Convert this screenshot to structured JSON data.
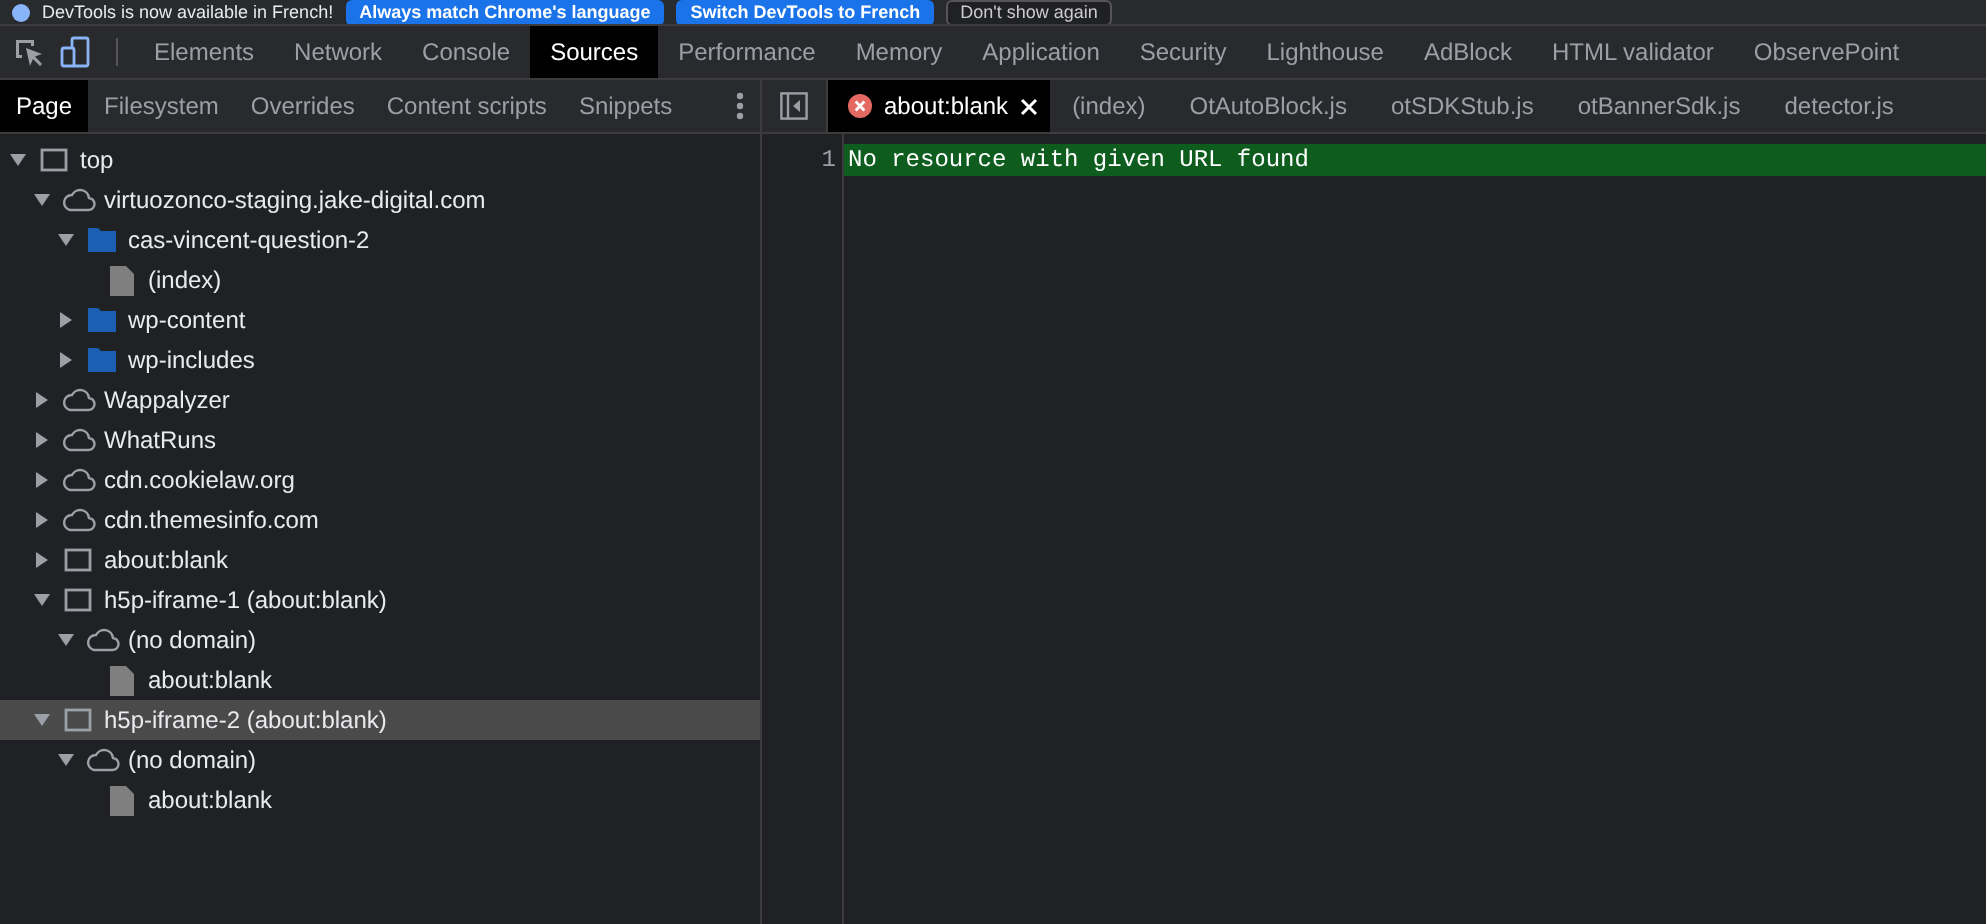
{
  "infobar": {
    "message": "DevTools is now available in French!",
    "buttons": [
      {
        "label": "Always match Chrome's language",
        "kind": "primary"
      },
      {
        "label": "Switch DevTools to French",
        "kind": "primary"
      },
      {
        "label": "Don't show again",
        "kind": "secondary"
      }
    ]
  },
  "main_tabs": [
    {
      "label": "Elements",
      "selected": false
    },
    {
      "label": "Network",
      "selected": false
    },
    {
      "label": "Console",
      "selected": false
    },
    {
      "label": "Sources",
      "selected": true
    },
    {
      "label": "Performance",
      "selected": false
    },
    {
      "label": "Memory",
      "selected": false
    },
    {
      "label": "Application",
      "selected": false
    },
    {
      "label": "Security",
      "selected": false
    },
    {
      "label": "Lighthouse",
      "selected": false
    },
    {
      "label": "AdBlock",
      "selected": false
    },
    {
      "label": "HTML validator",
      "selected": false
    },
    {
      "label": "ObservePoint",
      "selected": false
    }
  ],
  "navigator_tabs": [
    {
      "label": "Page",
      "selected": true
    },
    {
      "label": "Filesystem",
      "selected": false
    },
    {
      "label": "Overrides",
      "selected": false
    },
    {
      "label": "Content scripts",
      "selected": false
    },
    {
      "label": "Snippets",
      "selected": false
    }
  ],
  "tree": [
    {
      "label": "top",
      "kind": "frame",
      "expanded": true,
      "selected": false,
      "children": [
        {
          "label": "virtuozonco-staging.jake-digital.com",
          "kind": "domain",
          "expanded": true,
          "selected": false,
          "children": [
            {
              "label": "cas-vincent-question-2",
              "kind": "folder",
              "expanded": true,
              "selected": false,
              "children": [
                {
                  "label": "(index)",
                  "kind": "file",
                  "selected": false
                }
              ]
            },
            {
              "label": "wp-content",
              "kind": "folder",
              "expanded": false,
              "selected": false
            },
            {
              "label": "wp-includes",
              "kind": "folder",
              "expanded": false,
              "selected": false
            }
          ]
        },
        {
          "label": "Wappalyzer",
          "kind": "domain",
          "expanded": false,
          "selected": false
        },
        {
          "label": "WhatRuns",
          "kind": "domain",
          "expanded": false,
          "selected": false
        },
        {
          "label": "cdn.cookielaw.org",
          "kind": "domain",
          "expanded": false,
          "selected": false
        },
        {
          "label": "cdn.themesinfo.com",
          "kind": "domain",
          "expanded": false,
          "selected": false
        },
        {
          "label": "about:blank",
          "kind": "frame",
          "expanded": false,
          "selected": false
        },
        {
          "label": "h5p-iframe-1 (about:blank)",
          "kind": "frame",
          "expanded": true,
          "selected": false,
          "children": [
            {
              "label": "(no domain)",
              "kind": "domain",
              "expanded": true,
              "selected": false,
              "children": [
                {
                  "label": "about:blank",
                  "kind": "file",
                  "selected": false
                }
              ]
            }
          ]
        },
        {
          "label": "h5p-iframe-2 (about:blank)",
          "kind": "frame",
          "expanded": true,
          "selected": true,
          "children": [
            {
              "label": "(no domain)",
              "kind": "domain",
              "expanded": true,
              "selected": false,
              "children": [
                {
                  "label": "about:blank",
                  "kind": "file",
                  "selected": false
                }
              ]
            }
          ]
        }
      ]
    }
  ],
  "editor_tabs": [
    {
      "label": "about:blank",
      "selected": true,
      "error": true
    },
    {
      "label": "(index)",
      "selected": false,
      "error": false
    },
    {
      "label": "OtAutoBlock.js",
      "selected": false,
      "error": false
    },
    {
      "label": "otSDKStub.js",
      "selected": false,
      "error": false
    },
    {
      "label": "otBannerSdk.js",
      "selected": false,
      "error": false
    },
    {
      "label": "detector.js",
      "selected": false,
      "error": false
    }
  ],
  "editor_lines": [
    {
      "number": "1",
      "text": "No resource with given URL found",
      "highlighted": true
    }
  ]
}
